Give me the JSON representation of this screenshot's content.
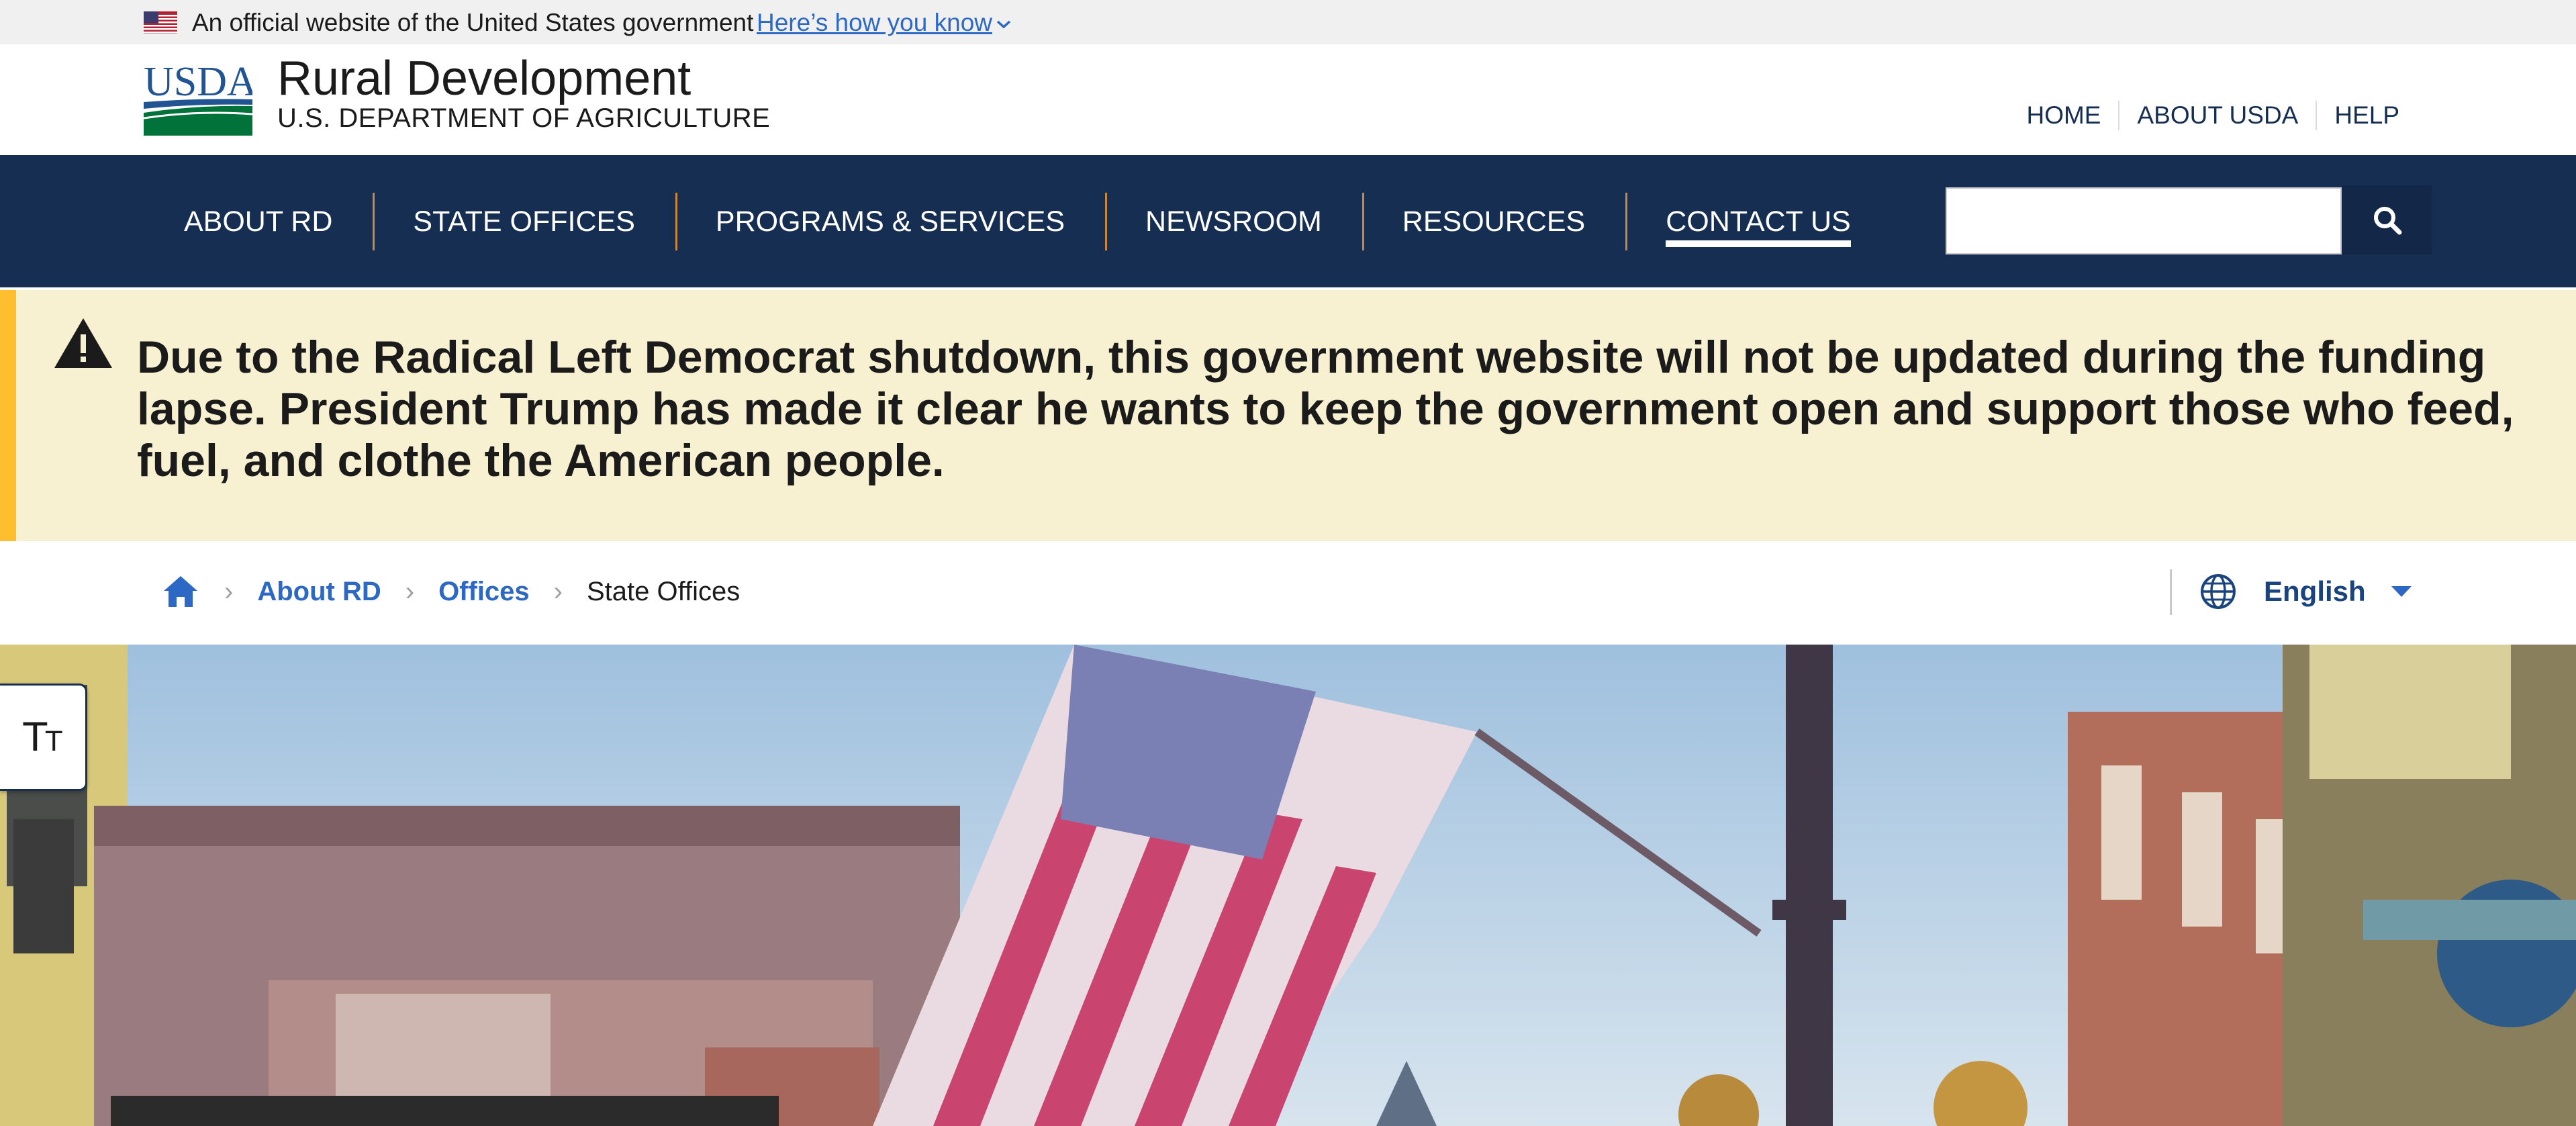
{
  "gov_banner": {
    "text": "An official website of the United States government",
    "link": "Here’s how you know"
  },
  "header": {
    "logo_text": "USDA",
    "title": "Rural Development",
    "subtitle": "U.S. DEPARTMENT OF AGRICULTURE",
    "util_links": [
      "HOME",
      "ABOUT USDA",
      "HELP"
    ]
  },
  "nav": {
    "items": [
      {
        "label": "ABOUT RD"
      },
      {
        "label": "STATE OFFICES"
      },
      {
        "label": "PROGRAMS & SERVICES"
      },
      {
        "label": "NEWSROOM"
      },
      {
        "label": "RESOURCES"
      },
      {
        "label": "CONTACT US",
        "active": true
      }
    ],
    "search_value": "",
    "search_icon": "search-icon"
  },
  "alert": {
    "icon": "warning-icon",
    "text": "Due to the Radical Left Democrat shutdown, this government website will not be updated during the funding lapse. President Trump has made it clear he wants to keep the government open and support those who feed, fuel, and clothe the American people."
  },
  "breadcrumb": {
    "home_icon": "home-icon",
    "items": [
      "About RD",
      "Offices"
    ],
    "current": "State Offices",
    "separator": "›"
  },
  "language": {
    "icon": "globe-icon",
    "label": "English"
  },
  "text_size_button": {
    "icon": "text-size-icon",
    "big": "T",
    "small": "T"
  },
  "colors": {
    "nav_bg": "#162e51",
    "alert_bg": "#f8f1d1",
    "alert_border": "#ffbe2e",
    "link": "#2d69c4",
    "nav_separator": "#c9883a"
  }
}
